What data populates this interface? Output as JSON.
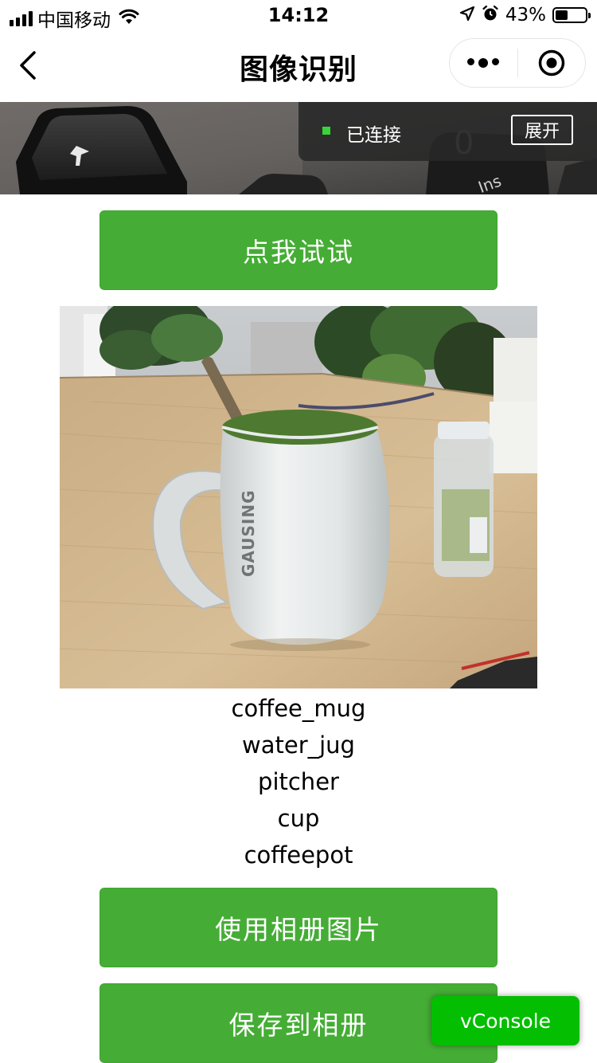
{
  "status_bar": {
    "carrier": "中国移动",
    "time": "14:12",
    "battery_percent": "43%",
    "battery_level": 0.43
  },
  "nav": {
    "title": "图像识别"
  },
  "camera": {
    "connection_status": "已连接",
    "expand_label": "展开",
    "key_label_zero": "0",
    "key_label_ins": "Ins"
  },
  "buttons": {
    "try": "点我试试",
    "use_album": "使用相册图片",
    "save_album": "保存到相册"
  },
  "photo": {
    "mug_text": "GAUSING"
  },
  "results": [
    "coffee_mug",
    "water_jug",
    "pitcher",
    "cup",
    "coffeepot"
  ],
  "vconsole": {
    "label": "vConsole"
  },
  "colors": {
    "accent_green": "#45ad35",
    "vconsole_green": "#04be02",
    "connected_dot": "#38d438"
  }
}
